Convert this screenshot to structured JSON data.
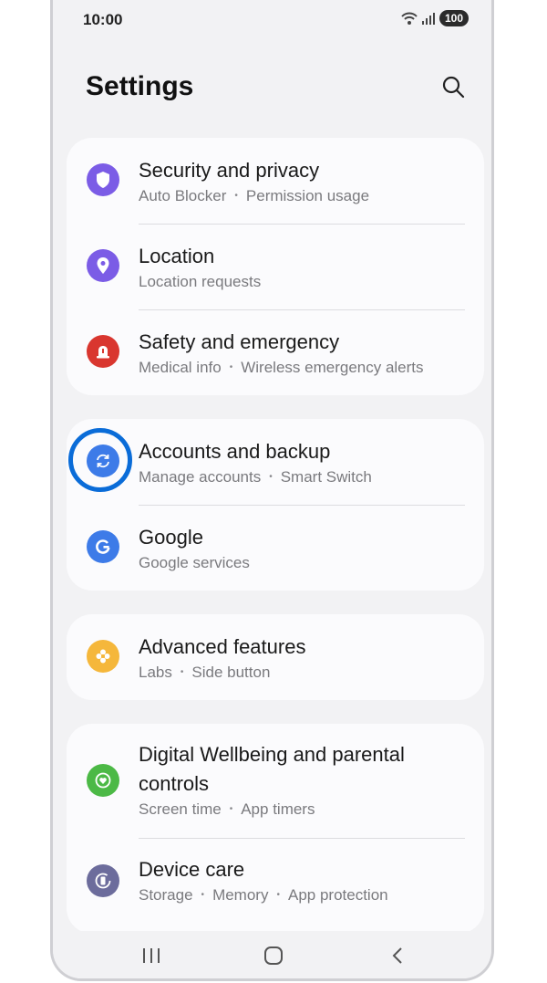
{
  "status": {
    "time": "10:00",
    "battery": "100"
  },
  "header": {
    "title": "Settings"
  },
  "cards": [
    {
      "items": [
        {
          "title": "Security and privacy",
          "subtitle": [
            "Auto Blocker",
            "Permission usage"
          ],
          "icon": "shield-icon",
          "color": "#7b5ce6"
        },
        {
          "title": "Location",
          "subtitle": [
            "Location requests"
          ],
          "icon": "location-pin-icon",
          "color": "#7b5ce6"
        },
        {
          "title": "Safety and emergency",
          "subtitle": [
            "Medical info",
            "Wireless emergency alerts"
          ],
          "icon": "siren-icon",
          "color": "#d9362f"
        }
      ]
    },
    {
      "items": [
        {
          "title": "Accounts and backup",
          "subtitle": [
            "Manage accounts",
            "Smart Switch"
          ],
          "icon": "sync-icon",
          "color": "#3d7be8"
        },
        {
          "title": "Google",
          "subtitle": [
            "Google services"
          ],
          "icon": "google-icon",
          "color": "#3d7be8"
        }
      ]
    },
    {
      "items": [
        {
          "title": "Advanced features",
          "subtitle": [
            "Labs",
            "Side button"
          ],
          "icon": "gear-flower-icon",
          "color": "#f5b73b"
        }
      ]
    },
    {
      "items": [
        {
          "title": "Digital Wellbeing and parental",
          "title2": "controls",
          "subtitle": [
            "Screen time",
            "App timers"
          ],
          "icon": "heart-circle-icon",
          "color": "#4cb946"
        },
        {
          "title": "Device care",
          "subtitle": [
            "Storage",
            "Memory",
            "App protection"
          ],
          "icon": "device-care-icon",
          "color": "#6c6c9c"
        }
      ]
    }
  ],
  "sep": "•"
}
